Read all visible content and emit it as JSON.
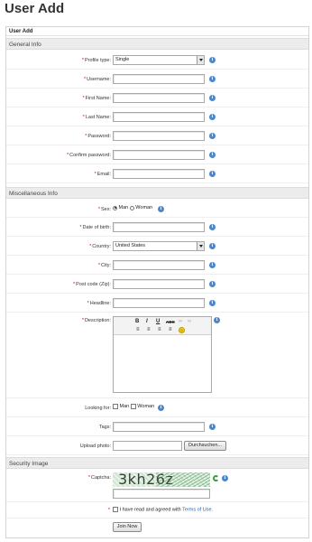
{
  "page": {
    "title": "User Add"
  },
  "form": {
    "caption": "User Add",
    "sections": {
      "general": "General Info",
      "misc": "Miscellaneous Info",
      "security": "Security Image"
    },
    "fields": {
      "profile_type": {
        "label": "Profile type:",
        "value": "Single"
      },
      "username": {
        "label": "Username:",
        "value": ""
      },
      "first_name": {
        "label": "First Name:",
        "value": ""
      },
      "last_name": {
        "label": "Last Name:",
        "value": ""
      },
      "password": {
        "label": "Password:",
        "value": ""
      },
      "confirm_password": {
        "label": "Confirm password:",
        "value": ""
      },
      "email": {
        "label": "Email:",
        "value": ""
      },
      "sex": {
        "label": "Sex:",
        "options": [
          "Man",
          "Woman"
        ],
        "selected": "Man"
      },
      "date_of_birth": {
        "label": "Date of birth:",
        "value": ""
      },
      "country": {
        "label": "Country:",
        "value": "United States"
      },
      "city": {
        "label": "City:",
        "value": ""
      },
      "post_code": {
        "label": "Post code (Zip):",
        "value": ""
      },
      "headline": {
        "label": "Headline:",
        "value": ""
      },
      "description": {
        "label": "Description:",
        "value": ""
      },
      "looking_for": {
        "label": "Looking for:",
        "options": [
          "Man",
          "Woman"
        ]
      },
      "tags": {
        "label": "Tags:",
        "value": ""
      },
      "upload_photo": {
        "label": "Upload photo:",
        "button": "Durchsuchen..."
      },
      "captcha": {
        "label": "Captcha:",
        "code": "3kh26z",
        "value": ""
      }
    },
    "required_marker": "*",
    "editor_toolbar": {
      "bold": "B",
      "italic": "I",
      "underline": "U",
      "strike": "ABC"
    },
    "terms": {
      "text": "I have read and agreed with",
      "link": "Terms of Use."
    },
    "submit_label": "Join Now",
    "info_glyph": "i",
    "icons": [
      "info-icon",
      "refresh-icon",
      "smiley-icon"
    ],
    "colors": {
      "info": "#4d86c8",
      "link": "#1f5fa8",
      "required": "#dd0000"
    }
  }
}
